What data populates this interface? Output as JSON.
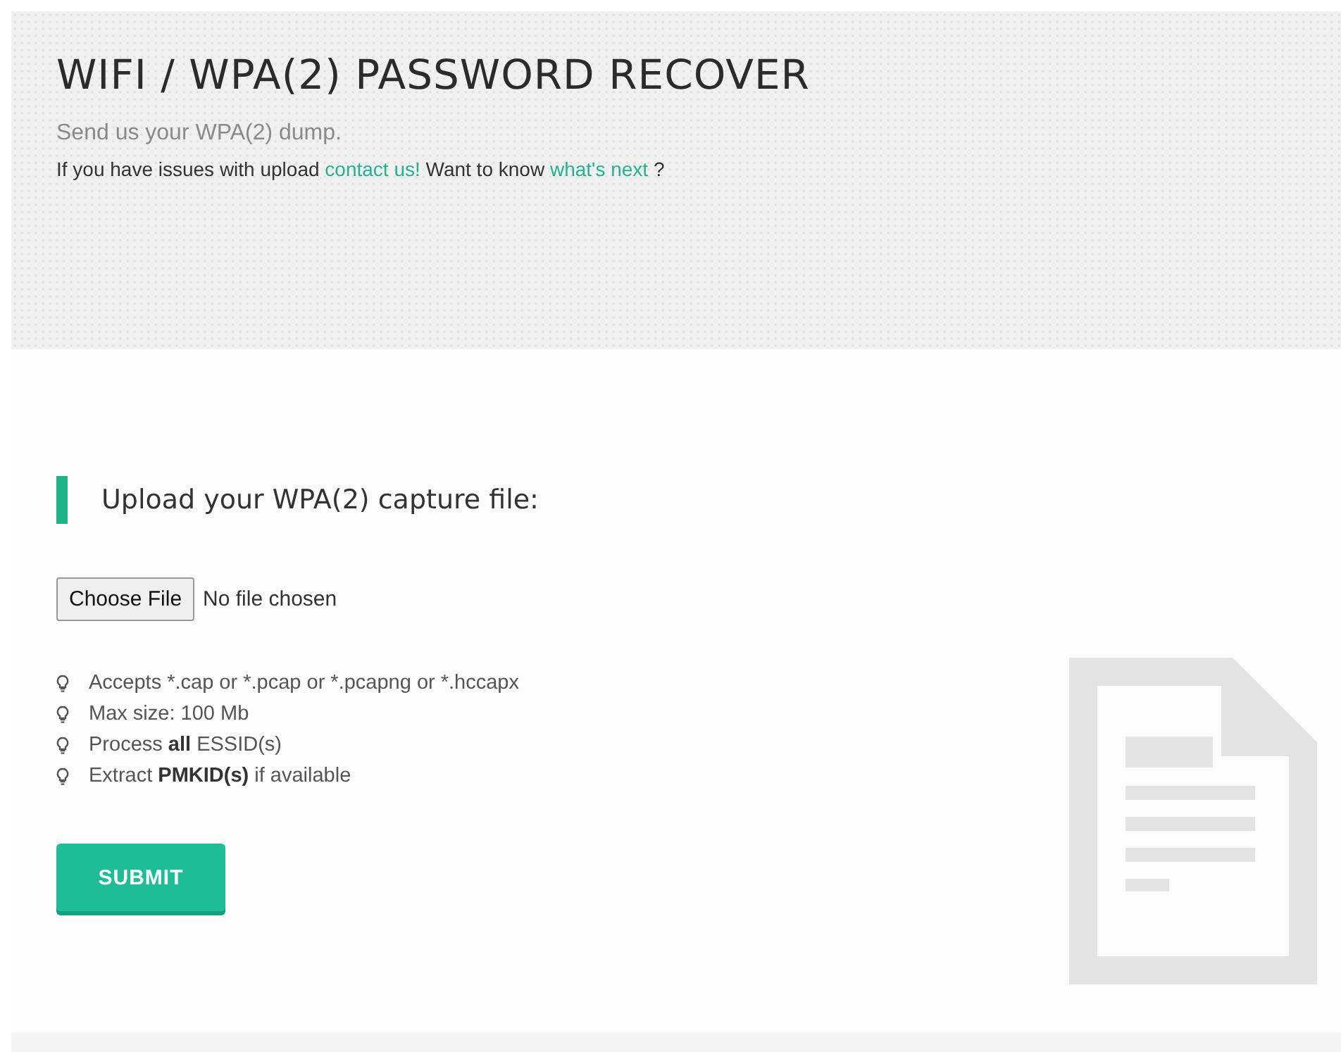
{
  "header": {
    "title": "WIFI / WPA(2) PASSWORD RECOVER",
    "subtitle": "Send us your WPA(2) dump.",
    "intro": [
      {
        "kind": "text",
        "text": "If you have issues with upload "
      },
      {
        "kind": "link",
        "text": "contact us!"
      },
      {
        "kind": "text",
        "text": " Want to know "
      },
      {
        "kind": "link",
        "text": "what's next"
      },
      {
        "kind": "text",
        "text": " ?"
      }
    ]
  },
  "upload": {
    "heading": "Upload your WPA(2) capture file:",
    "file_button": "Choose File",
    "file_status": "No file chosen",
    "notes": [
      "Accepts *.cap or *.pcap or *.pcapng or *.hccapx",
      "Max size: 100 Mb",
      "Process **all** ESSID(s)",
      "Extract **PMKID(s)** if available"
    ],
    "submit": "SUBMIT"
  }
}
